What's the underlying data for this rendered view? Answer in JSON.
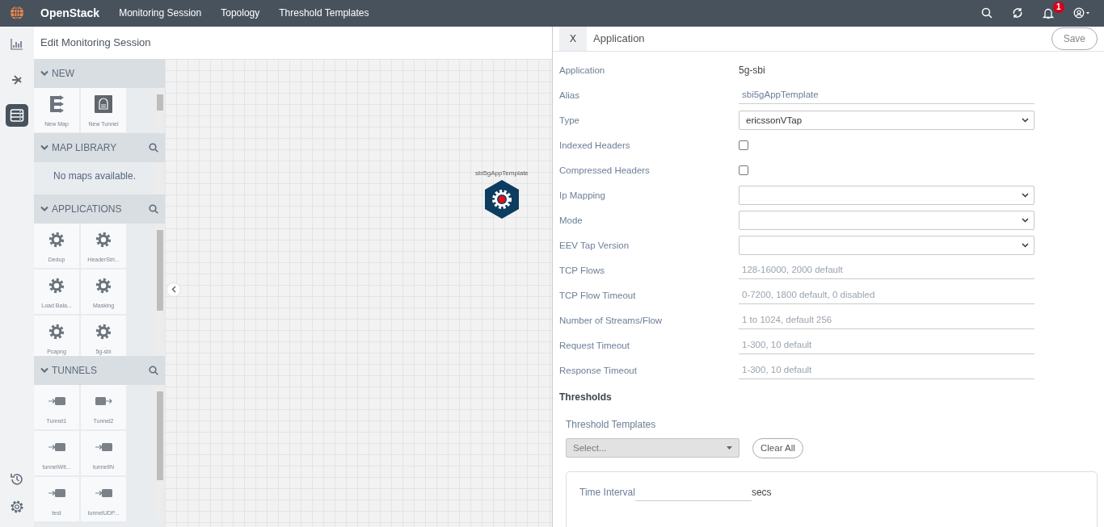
{
  "navbar": {
    "brand": "OpenStack",
    "links": [
      "Monitoring Session",
      "Topology",
      "Threshold Templates"
    ],
    "notification_count": "1"
  },
  "rail": {
    "items": [
      {
        "kind": "chart",
        "selected": false
      },
      {
        "kind": "share",
        "selected": false
      },
      {
        "kind": "list",
        "selected": true
      }
    ],
    "bottom": [
      {
        "kind": "history"
      },
      {
        "kind": "settings"
      }
    ]
  },
  "page_title": "Edit Monitoring Session",
  "palette": {
    "sections": [
      {
        "title": "NEW",
        "searchable": false,
        "tiles": [
          {
            "label": "New Map",
            "kind": "map"
          },
          {
            "label": "New Tunnel",
            "kind": "new-tunnel"
          }
        ]
      },
      {
        "title": "MAP LIBRARY",
        "searchable": true,
        "empty_text": "No maps available."
      },
      {
        "title": "APPLICATIONS",
        "searchable": true,
        "tiles": [
          {
            "label": "Dedup",
            "kind": "app"
          },
          {
            "label": "HeaderStri...",
            "kind": "app"
          },
          {
            "label": "Load Bala...",
            "kind": "app"
          },
          {
            "label": "Masking",
            "kind": "app"
          },
          {
            "label": "Pcapng",
            "kind": "app"
          },
          {
            "label": "5g-sbi",
            "kind": "app"
          }
        ]
      },
      {
        "title": "TUNNELS",
        "searchable": true,
        "tiles": [
          {
            "label": "Tunnel1",
            "kind": "tunnel-in"
          },
          {
            "label": "Tunnel2",
            "kind": "tunnel-out"
          },
          {
            "label": "tunnelWit...",
            "kind": "tunnel-in"
          },
          {
            "label": "tunnelIN",
            "kind": "tunnel-in"
          },
          {
            "label": "test",
            "kind": "tunnel-in"
          },
          {
            "label": "tunnelUDP...",
            "kind": "tunnel-in"
          }
        ]
      }
    ]
  },
  "canvas": {
    "nodes": [
      {
        "label": "sbi5gAppTemplate"
      }
    ]
  },
  "panel": {
    "close": "X",
    "title": "Application",
    "save": "Save",
    "fields": [
      {
        "kind": "text",
        "label": "Application",
        "value": "5g-sbi"
      },
      {
        "kind": "input",
        "label": "Alias",
        "value": "sbi5gAppTemplate"
      },
      {
        "kind": "select",
        "label": "Type",
        "value": "ericssonVTap"
      },
      {
        "kind": "checkbox",
        "label": "Indexed Headers",
        "checked": false
      },
      {
        "kind": "checkbox",
        "label": "Compressed Headers",
        "checked": false
      },
      {
        "kind": "select",
        "label": "Ip Mapping"
      },
      {
        "kind": "select",
        "label": "Mode"
      },
      {
        "kind": "select",
        "label": "EEV Tap Version"
      },
      {
        "kind": "input",
        "label": "TCP Flows",
        "placeholder": "128-16000, 2000 default"
      },
      {
        "kind": "input",
        "label": "TCP Flow Timeout",
        "placeholder": "0-7200, 1800 default, 0 disabled"
      },
      {
        "kind": "input",
        "label": "Number of Streams/Flow",
        "placeholder": "1 to 1024, default 256"
      },
      {
        "kind": "input",
        "label": "Request Timeout",
        "placeholder": "1-300, 10 default"
      },
      {
        "kind": "input",
        "label": "Response Timeout",
        "placeholder": "1-300, 10 default"
      }
    ],
    "thresholds": {
      "title": "Thresholds",
      "templates_label": "Threshold Templates",
      "select_placeholder": "Select...",
      "clear": "Clear All",
      "interval_label": "Time Interval",
      "unit": "secs"
    }
  }
}
